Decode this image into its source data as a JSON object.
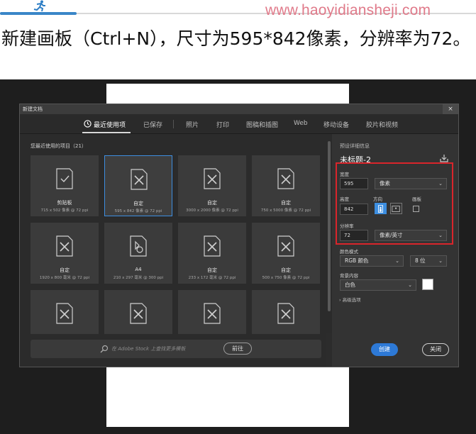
{
  "header": {
    "site_url": "www.haoyidiansheji.com",
    "caption": "新建画板（Ctrl+N），尺寸为595*842像素，分辨率为72。"
  },
  "dialog": {
    "title": "新建文档",
    "close_glyph": "×",
    "tabs": [
      {
        "label": "最近使用项",
        "active": true
      },
      {
        "label": "已保存",
        "active": false
      },
      {
        "label": "照片",
        "active": false
      },
      {
        "label": "打印",
        "active": false
      },
      {
        "label": "图稿和插图",
        "active": false
      },
      {
        "label": "Web",
        "active": false
      },
      {
        "label": "移动设备",
        "active": false
      },
      {
        "label": "胶片和视频",
        "active": false
      }
    ],
    "recent_title": "您最近使用的项目（21）",
    "cards": [
      {
        "name": "剪贴板",
        "size": "715 x 502 像素 @ 72 ppi",
        "icon": "clipboard-icon"
      },
      {
        "name": "自定",
        "size": "595 x 842 像素 @ 72 ppi",
        "icon": "document-x-icon",
        "selected": true
      },
      {
        "name": "自定",
        "size": "3000 x 2000 像素 @ 72 ppi",
        "icon": "document-x-icon"
      },
      {
        "name": "自定",
        "size": "750 x 5000 像素 @ 72 ppi",
        "icon": "document-x-icon"
      },
      {
        "name": "自定",
        "size": "1920 x 800 毫米 @ 72 ppi",
        "icon": "document-x-icon"
      },
      {
        "name": "A4",
        "size": "210 x 297 毫米 @ 300 ppi",
        "icon": "document-shapes-icon"
      },
      {
        "name": "自定",
        "size": "233 x 172 毫米 @ 72 ppi",
        "icon": "document-x-icon"
      },
      {
        "name": "自定",
        "size": "500 x 750 像素 @ 72 ppi",
        "icon": "document-x-icon"
      },
      {
        "name": "",
        "size": "",
        "icon": "document-x-icon"
      },
      {
        "name": "",
        "size": "",
        "icon": "document-x-icon"
      },
      {
        "name": "",
        "size": "",
        "icon": "document-x-icon"
      },
      {
        "name": "",
        "size": "",
        "icon": "document-x-icon"
      }
    ],
    "search": {
      "placeholder": "在 Adobe Stock 上查找更多模板",
      "go_label": "前往"
    },
    "preset": {
      "section_label": "预设详细信息",
      "doc_name": "未标题-2",
      "width_label": "宽度",
      "width_value": "595",
      "width_unit": "像素",
      "height_label": "高度",
      "height_value": "842",
      "orientation_label": "方向",
      "artboard_label": "画板",
      "resolution_label": "分辨率",
      "resolution_value": "72",
      "resolution_unit": "像素/英寸",
      "color_mode_label": "颜色模式",
      "color_mode_value": "RGB 颜色",
      "bit_depth_value": "8 位",
      "background_label": "背景内容",
      "background_value": "白色",
      "advanced_label": "› 高级选项"
    },
    "buttons": {
      "create": "创建",
      "close": "关闭"
    }
  },
  "colors": {
    "accent": "#3d8ee0",
    "highlight": "#d9252b",
    "dialog_bg": "#2c2c2c"
  }
}
